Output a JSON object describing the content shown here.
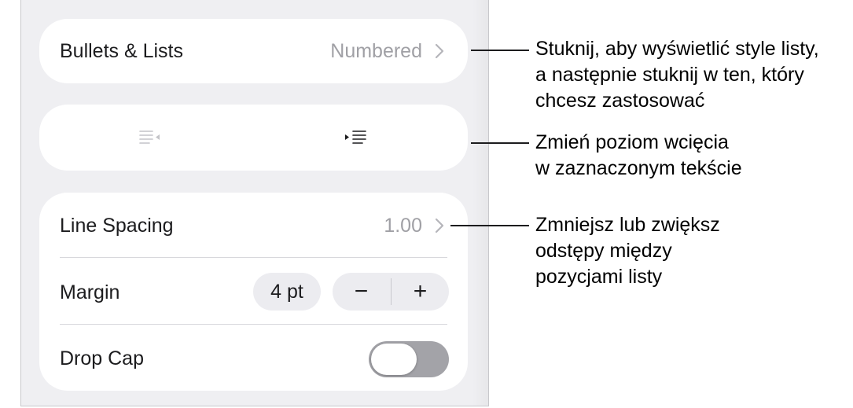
{
  "bullets": {
    "label": "Bullets & Lists",
    "value": "Numbered"
  },
  "indent": {
    "decrease_icon": "outdent-icon",
    "increase_icon": "indent-icon"
  },
  "spacing": {
    "line_spacing_label": "Line Spacing",
    "line_spacing_value": "1.00",
    "margin_label": "Margin",
    "margin_value": "4 pt",
    "minus": "−",
    "plus": "+",
    "drop_cap_label": "Drop Cap",
    "drop_cap_on": false
  },
  "callouts": {
    "bullets": "Stuknij, aby wyświetlić style listy,\na następnie stuknij w ten, który\nchcesz zastosować",
    "indent": "Zmień poziom wcięcia\nw zaznaczonym tekście",
    "spacing": "Zmniejsz lub zwiększ\nodstępy między\npozycjami listy"
  },
  "colors": {
    "panel": "#efeff2",
    "card": "#ffffff",
    "secondary_text": "#a0a0a5",
    "toggle_off": "#a3a3a8"
  }
}
